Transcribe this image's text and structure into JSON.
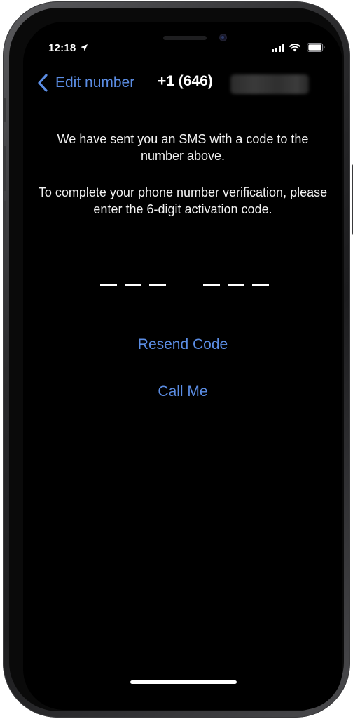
{
  "status_bar": {
    "time": "12:18",
    "icons": [
      "location-arrow-icon",
      "cellular-signal-icon",
      "wifi-icon",
      "battery-icon"
    ]
  },
  "nav": {
    "back_label": "Edit number",
    "back_icon": "chevron-left-icon",
    "phone_prefix": "+1 (646)"
  },
  "messages": {
    "sms_sent": "We have sent you an SMS with a code to the number above.",
    "instructions": "To complete your phone number verification, please enter the 6-digit activation code."
  },
  "code_input": {
    "digits": 6,
    "value": ""
  },
  "actions": {
    "resend": "Resend Code",
    "call": "Call Me"
  },
  "colors": {
    "background": "#000000",
    "text": "#f2f2f2",
    "accent": "#5b8de4"
  }
}
